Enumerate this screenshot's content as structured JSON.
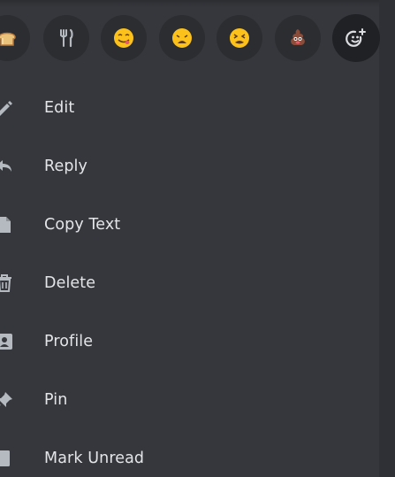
{
  "reactions": [
    {
      "name": "bread-icon",
      "kind": "bread"
    },
    {
      "name": "fork-and-knife-icon",
      "kind": "fork-knife"
    },
    {
      "name": "face-savoring-food-emoji-icon",
      "kind": "yum"
    },
    {
      "name": "weary-face-emoji-icon",
      "kind": "weary"
    },
    {
      "name": "tired-face-emoji-icon",
      "kind": "tired"
    },
    {
      "name": "pile-of-poo-emoji-icon",
      "kind": "poo"
    },
    {
      "name": "add-reaction-icon",
      "kind": "add"
    }
  ],
  "menu": {
    "items": [
      {
        "id": "edit",
        "label": "Edit",
        "icon": "pencil-icon"
      },
      {
        "id": "reply",
        "label": "Reply",
        "icon": "reply-arrow-icon"
      },
      {
        "id": "copy-text",
        "label": "Copy Text",
        "icon": "copy-document-icon"
      },
      {
        "id": "delete",
        "label": "Delete",
        "icon": "trash-icon"
      },
      {
        "id": "profile",
        "label": "Profile",
        "icon": "id-card-icon"
      },
      {
        "id": "pin",
        "label": "Pin",
        "icon": "pin-icon"
      },
      {
        "id": "mark-unread",
        "label": "Mark Unread",
        "icon": "unread-flag-icon"
      }
    ]
  },
  "colors": {
    "background": "#35373c",
    "text": "#e3e5e8",
    "icon": "#b5bac1",
    "emoji_yellow": "#fcc21b",
    "poo_brown": "#8b4d3a"
  }
}
